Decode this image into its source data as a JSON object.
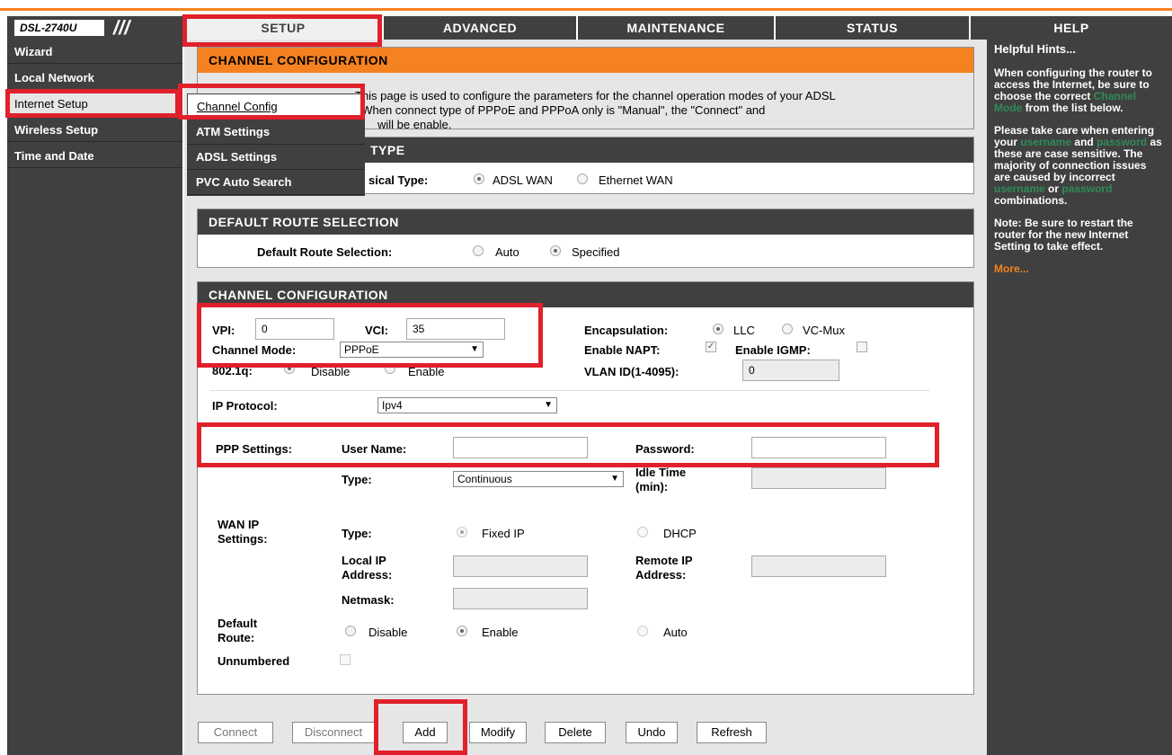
{
  "app": {
    "model": "DSL-2740U"
  },
  "tabs": [
    "SETUP",
    "ADVANCED",
    "MAINTENANCE",
    "STATUS",
    "HELP"
  ],
  "sidebar": [
    "Wizard",
    "Local Network",
    "Internet Setup",
    "Wireless Setup",
    "Time and Date"
  ],
  "submenu": [
    "Channel Config",
    "ATM Settings",
    "ADSL Settings",
    "PVC Auto Search"
  ],
  "intro": {
    "title": "CHANNEL CONFIGURATION",
    "line1": "This page is used to configure the parameters for the channel operation modes of your ADSL",
    "line2_pre": "",
    "line2": ": When connect type of PPPoE and PPPoA only is \"Manual\", the \"Connect\" and",
    "line3": "will be enable."
  },
  "wan_type": {
    "title": "TYPE",
    "label": "sical Type:",
    "opt1": "ADSL WAN",
    "opt2": "Ethernet WAN"
  },
  "default_route": {
    "title": "DEFAULT ROUTE SELECTION",
    "label": "Default Route Selection:",
    "opt1": "Auto",
    "opt2": "Specified"
  },
  "channel": {
    "title": "CHANNEL CONFIGURATION",
    "vpi_label": "VPI:",
    "vpi": "0",
    "vci_label": "VCI:",
    "vci": "35",
    "encap_label": "Encapsulation:",
    "encap1": "LLC",
    "encap2": "VC-Mux",
    "mode_label": "Channel Mode:",
    "mode": "PPPoE",
    "napt_label": "Enable NAPT:",
    "igmp_label": "Enable IGMP:",
    "dot1q_label": "802.1q:",
    "dot1q1": "Disable",
    "dot1q2": "Enable",
    "vlan_label": "VLAN ID(1-4095):",
    "vlan": "0",
    "ipproto_label": "IP Protocol:",
    "ipproto": "Ipv4",
    "ppp_label": "PPP Settings:",
    "user_label": "User Name:",
    "pass_label": "Password:",
    "type_label": "Type:",
    "ppp_type": "Continuous",
    "idle_label1": "Idle Time",
    "idle_label2": "(min):",
    "wanip_label1": "WAN IP",
    "wanip_label2": "Settings:",
    "wan_type_label": "Type:",
    "fixed_ip": "Fixed IP",
    "dhcp": "DHCP",
    "local_ip1": "Local IP",
    "local_ip2": "Address:",
    "remote_ip1": "Remote IP",
    "remote_ip2": "Address:",
    "netmask": "Netmask:",
    "droute1": "Default",
    "droute2": "Route:",
    "dr_disable": "Disable",
    "dr_enable": "Enable",
    "dr_auto": "Auto",
    "unnumbered": "Unnumbered"
  },
  "buttons": [
    "Connect",
    "Disconnect",
    "Add",
    "Modify",
    "Delete",
    "Undo",
    "Refresh"
  ],
  "help": {
    "title": "Helpful Hints...",
    "p1a": "When configuring the router to access the Internet, be sure to choose the correct",
    "p1hl": "Channel Mode",
    "p1b": "from the list below.",
    "p2a": "Please take care when entering your",
    "p2hl1": "username",
    "p2b": "and",
    "p2hl2": "password",
    "p2c": "as these are case sensitive. The majority of connection issues are caused by incorrect",
    "p2hl3": "username",
    "p2d": "or",
    "p2hl4": "password",
    "p2e": "combinations.",
    "p3": "Note: Be sure to restart the router for the new Internet Setting to take effect.",
    "more": "More..."
  },
  "colors": {
    "accent": "#f58220",
    "dark": "#404040",
    "highlight": "#e0202b"
  }
}
